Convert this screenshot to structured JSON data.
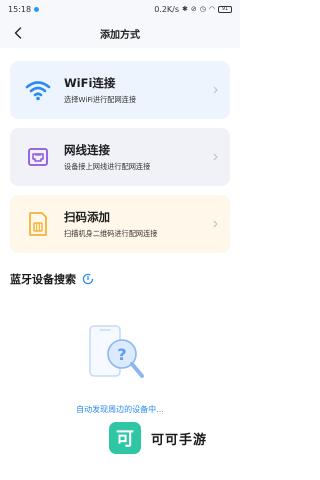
{
  "status_bar": {
    "time": "15:18",
    "speed": "0.2K/s",
    "battery": "91"
  },
  "header": {
    "title": "添加方式"
  },
  "options": [
    {
      "title": "WiFi连接",
      "subtitle": "选择WiFi进行配网连接",
      "icon": "wifi-icon"
    },
    {
      "title": "网线连接",
      "subtitle": "设备接上网线进行配网连接",
      "icon": "ethernet-port-icon"
    },
    {
      "title": "扫码添加",
      "subtitle": "扫描机身二维码进行配网连接",
      "icon": "sim-card-icon"
    }
  ],
  "bluetooth": {
    "title": "蓝牙设备搜索",
    "searching_text": "自动发现周边的设备中..."
  },
  "watermark": {
    "logo_char": "可",
    "text": "可可手游"
  },
  "colors": {
    "accent": "#2a8bf5",
    "wifi_card_bg": "#eef4fd",
    "ethernet_card_bg": "#f0f2f7",
    "scan_card_bg": "#fff8ea",
    "ethernet_icon": "#8a56e2",
    "scan_icon": "#f3b23a",
    "watermark_logo": "#2fc6a6"
  }
}
